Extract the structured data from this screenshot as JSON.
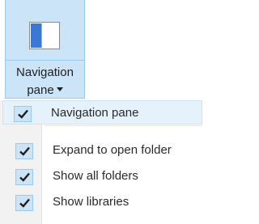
{
  "ribbon": {
    "button": {
      "label_line1": "Navigation",
      "label_line2": "pane",
      "icon": "navigation-pane-icon",
      "dropdown_icon": "chevron-down-icon"
    }
  },
  "menu": {
    "items": [
      {
        "label": "Navigation pane",
        "checked": true,
        "icon": "checkmark-icon"
      },
      {
        "label": "Expand to open folder",
        "checked": true,
        "icon": "checkmark-icon"
      },
      {
        "label": "Show all folders",
        "checked": true,
        "icon": "checkmark-icon"
      },
      {
        "label": "Show libraries",
        "checked": true,
        "icon": "checkmark-icon"
      }
    ]
  },
  "colors": {
    "selected_fill": "#cce4f7",
    "selected_border": "#99c9ef",
    "hover_fill": "#e5f1fb",
    "icon_blue": "#3b78d4",
    "checkmark": "#1e1e1e"
  }
}
